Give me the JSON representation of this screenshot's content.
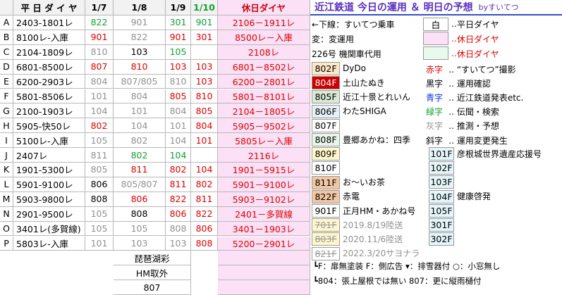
{
  "colors": {
    "red": "#e00000",
    "green": "#10a030",
    "gray": "#909090",
    "holiday_bg": "#fbe0f6",
    "title": "#5a2fc0"
  },
  "table": {
    "header": {
      "weekday": "平 日 ダ イ ヤ",
      "d1": "1/7",
      "d2": "1/8",
      "d3": "1/9",
      "d4": "1/10",
      "holiday": "休日ダイヤ"
    },
    "rows": [
      {
        "k": "A",
        "w": "2403-1801レ",
        "d1": "822",
        "d1c": "green",
        "d2": "901",
        "d2c": "gray",
        "d3": "301",
        "d3c": "green",
        "d4": "901",
        "d4c": "green",
        "h": "2106－1911レ",
        "hc": "red"
      },
      {
        "k": "B",
        "w": "8100レ-入庫",
        "d1": "901",
        "d1c": "red",
        "d2": "822",
        "d2c": "gray",
        "d3": "901",
        "d3c": "red",
        "d4": "301",
        "d4c": "red",
        "h": "8500レ－入庫",
        "hc": "red"
      },
      {
        "k": "C",
        "w": "2104-1809レ",
        "d1": "810",
        "d1c": "gray",
        "d2": "103",
        "d2c": "black",
        "d3": "105",
        "d3c": "green",
        "d4": "",
        "d4c": "black",
        "h": "2108レ",
        "hc": "red"
      },
      {
        "k": "D",
        "w": "6801-8500レ",
        "d1": "807",
        "d1c": "red",
        "d2": "810",
        "d2c": "red",
        "d3": "103",
        "d3c": "red",
        "d4": "103",
        "d4c": "red",
        "h": "6801－8502レ",
        "hc": "red"
      },
      {
        "k": "E",
        "w": "6200-2903レ",
        "d1": "804",
        "d1c": "gray",
        "d2": "807/805",
        "d2c": "gray",
        "d3": "810",
        "d3c": "gray",
        "d4": "103",
        "d4c": "red",
        "h": "6200－2801レ",
        "hc": "red"
      },
      {
        "k": "F",
        "w": "5801-8506レ",
        "d1": "101",
        "d1c": "gray",
        "d2": "804",
        "d2c": "gray",
        "d3": "805",
        "d3c": "red",
        "d4": "810",
        "d4c": "red",
        "h": "5801－8101レ",
        "hc": "red"
      },
      {
        "k": "G",
        "w": "2100-1903レ",
        "d1": "104",
        "d1c": "gray",
        "d2": "101",
        "d2c": "gray",
        "d3": "804",
        "d3c": "gray",
        "d4": "805",
        "d4c": "red",
        "h": "2104－1805レ",
        "hc": "red"
      },
      {
        "k": "H",
        "w": "5905-快50レ",
        "d1": "802",
        "d1c": "red",
        "d2": "104",
        "d2c": "gray",
        "d3": "101",
        "d3c": "gray",
        "d4": "804",
        "d4c": "red",
        "h": "5905－9502レ",
        "hc": "red"
      },
      {
        "k": "I",
        "w": "5100レ-入庫",
        "d1": "105",
        "d1c": "gray",
        "d2": "802",
        "d2c": "gray",
        "d3": "104",
        "d3c": "gray",
        "d4": "101",
        "d4c": "red",
        "h": "5805レ－入庫",
        "hc": "red"
      },
      {
        "k": "J",
        "w": "2407レ",
        "d1": "811",
        "d1c": "gray",
        "d2": "802",
        "d2c": "green",
        "d3": "104",
        "d3c": "green",
        "d4": "",
        "d4c": "black",
        "h": "2116レ",
        "hc": "red"
      },
      {
        "k": "K",
        "w": "1901-5300レ",
        "d1": "805",
        "d1c": "gray",
        "d2": "811",
        "d2c": "red",
        "d3": "802",
        "d3c": "red",
        "d4": "104",
        "d4c": "red",
        "h": "1901－5915レ",
        "hc": "red"
      },
      {
        "k": "L",
        "w": "5901-9100レ",
        "d1": "806",
        "d1c": "black",
        "d2": "805/807",
        "d2c": "gray",
        "d3": "811",
        "d3c": "red",
        "d4": "802",
        "d4c": "red",
        "h": "5901－9100レ",
        "hc": "red"
      },
      {
        "k": "M",
        "w": "5903-9800レ",
        "d1": "808",
        "d1c": "black",
        "d2": "806",
        "d2c": "red",
        "d3": "822",
        "d3c": "red",
        "d4": "811",
        "d4c": "red",
        "h": "5903－9102レ",
        "hc": "red"
      },
      {
        "k": "N",
        "w": "2901-9500レ",
        "d1": "105",
        "d1c": "gray",
        "d2": "808",
        "d2c": "black",
        "d3": "806",
        "d3c": "red",
        "d4": "822",
        "d4c": "red",
        "h": "2401－多賀線",
        "hc": "red"
      },
      {
        "k": "O",
        "w": "3401レ(多賀線)",
        "d1": "105",
        "d1c": "gray",
        "d2": "105",
        "d2c": "gray",
        "d3": "808",
        "d3c": "gray",
        "d4": "806",
        "d4c": "red",
        "h": "3401－1903レ",
        "hc": "red"
      },
      {
        "k": "P",
        "w": "5803レ-入庫",
        "d1": "101",
        "d1c": "gray",
        "d2": "103",
        "d2c": "gray",
        "d3": "103",
        "d3c": "gray",
        "d4": "808",
        "d4c": "red",
        "h": "5200－2901レ",
        "hc": "red"
      }
    ],
    "extra": [
      {
        "label": "琵琶湖彩",
        "value": ""
      },
      {
        "label": "HM取外",
        "value": ""
      },
      {
        "label": "807",
        "value": ""
      }
    ]
  },
  "panel": {
    "title": "近江鉄道 今日の運用 ＆ 明日の予想",
    "by": "byすいてつ",
    "legend_left": [
      "←下線：すいてつ乗車",
      "変：変運用",
      "226号 機関車代用"
    ],
    "legend_right": [
      {
        "box": "白",
        "label": "平日ダイヤ"
      },
      {
        "box": "",
        "label": "休日ダイヤ"
      },
      {
        "box": "",
        "label": "休日ダイヤ"
      }
    ],
    "cars": [
      {
        "no": "802F",
        "name": "DyDo"
      },
      {
        "no": "804F",
        "name": "土山たぬき"
      },
      {
        "no": "805F",
        "name": "近江十景とれいん"
      },
      {
        "no": "806F",
        "name": "わたSHIGA"
      },
      {
        "no": "807F",
        "name": ""
      },
      {
        "no": "808F",
        "name": "豊郷あかね：四季"
      },
      {
        "no": "809F",
        "name": ""
      },
      {
        "no": "810F",
        "name": ""
      },
      {
        "no": "811F",
        "name": "お～いお茶"
      },
      {
        "no": "822F",
        "name": "赤電"
      },
      {
        "no": "901F",
        "name": "正月HM・あかね号"
      },
      {
        "no": "701F",
        "name": "2019.8/19陸送"
      },
      {
        "no": "803F",
        "name": "2020.11/6陸送"
      },
      {
        "no": "821F",
        "name": "2022.3/20サヨナラ"
      }
    ],
    "color_key": [
      {
        "k": "赤字",
        "label": "“すいてつ”撮影"
      },
      {
        "k": "黒字",
        "label": "運用確認"
      },
      {
        "k": "青字",
        "label": "近江鉄道発表etc."
      },
      {
        "k": "緑字",
        "label": "伝聞・検索"
      },
      {
        "k": "灰字",
        "label": "推測・予想"
      },
      {
        "k": "斜字",
        "label": "運用変更発生"
      }
    ],
    "locos": [
      {
        "no": "101F",
        "name": "彦根城世界遺産応援号"
      },
      {
        "no": "102F",
        "name": ""
      },
      {
        "no": "103F",
        "name": ""
      },
      {
        "no": "104F",
        "name": "健康啓発"
      },
      {
        "no": "105F",
        "name": ""
      },
      {
        "no": "301F",
        "name": ""
      },
      {
        "no": "302F",
        "name": ""
      }
    ],
    "notes": [
      "┗F：扉無塗装  F：側広告  ▾：排雪器付  ○：小窓無し",
      "┗804：張上屋根では無い  807：更に縦雨樋付"
    ]
  }
}
